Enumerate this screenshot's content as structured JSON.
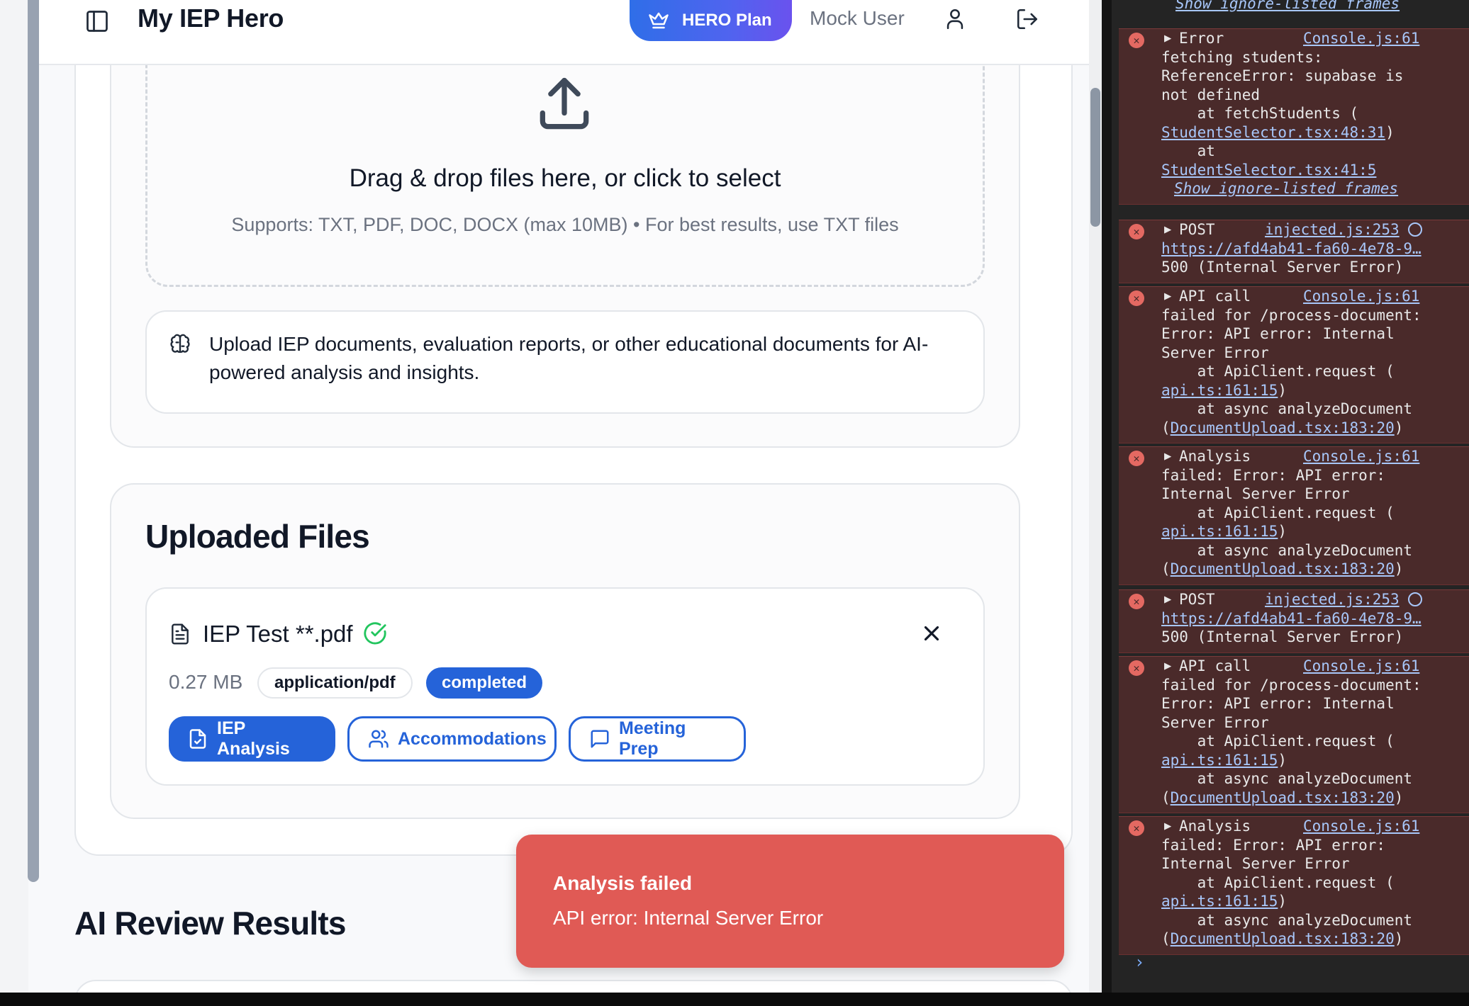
{
  "app": {
    "title": "My IEP Hero",
    "plan_label": "HERO Plan",
    "user_name": "Mock User"
  },
  "upload": {
    "title": "Drag & drop files here, or click to select",
    "subtitle": "Supports: TXT, PDF, DOC, DOCX (max 10MB) • For best results, use TXT files",
    "info": "Upload IEP documents, evaluation reports, or other educational documents for AI-powered analysis and insights."
  },
  "files": {
    "heading": "Uploaded Files",
    "items": [
      {
        "name": "IEP Test **.pdf",
        "size": "0.27 MB",
        "mime": "application/pdf",
        "status": "completed",
        "actions": [
          "IEP Analysis",
          "Accommodations",
          "Meeting Prep"
        ]
      }
    ]
  },
  "review": {
    "heading": "AI Review Results"
  },
  "toast": {
    "title": "Analysis failed",
    "message": "API error: Internal Server Error"
  },
  "console": {
    "top_ignored": "Show ignore-listed frames",
    "messages": [
      {
        "head": "Error",
        "source": "Console.js:61",
        "lines": [
          "fetching students:",
          "ReferenceError: supabase is",
          "not defined",
          "    at fetchStudents (",
          "StudentSelector.tsx:48:31)",
          "    at",
          "StudentSelector.tsx:41:5"
        ],
        "ignored": "Show ignore-listed frames"
      },
      {
        "head": "POST",
        "source": "injected.js:253",
        "lines": [
          "https://afd4ab41-fa60-4e78-9…",
          "500 (Internal Server Error)"
        ]
      },
      {
        "head": "API call",
        "source": "Console.js:61",
        "lines": [
          "failed for /process-document:",
          "Error: API error: Internal",
          "Server Error",
          "    at ApiClient.request (",
          "api.ts:161:15)",
          "    at async analyzeDocument",
          "(DocumentUpload.tsx:183:20)"
        ]
      },
      {
        "head": "Analysis",
        "source": "Console.js:61",
        "lines": [
          "failed: Error: API error:",
          "Internal Server Error",
          "    at ApiClient.request (",
          "api.ts:161:15)",
          "    at async analyzeDocument",
          "(DocumentUpload.tsx:183:20)"
        ]
      },
      {
        "head": "POST",
        "source": "injected.js:253",
        "lines": [
          "https://afd4ab41-fa60-4e78-9…",
          "500 (Internal Server Error)"
        ]
      },
      {
        "head": "API call",
        "source": "Console.js:61",
        "lines": [
          "failed for /process-document:",
          "Error: API error: Internal",
          "Server Error",
          "    at ApiClient.request (",
          "api.ts:161:15)",
          "    at async analyzeDocument",
          "(DocumentUpload.tsx:183:20)"
        ]
      },
      {
        "head": "Analysis",
        "source": "Console.js:61",
        "lines": [
          "failed: Error: API error:",
          "Internal Server Error",
          "    at ApiClient.request (",
          "api.ts:161:15)",
          "    at async analyzeDocument",
          "(DocumentUpload.tsx:183:20)"
        ]
      }
    ],
    "prompt": "›"
  },
  "colors": {
    "primary": "#2563d9",
    "toast_bg": "#e05a55",
    "success": "#22c55e",
    "console_error_bg": "#4a2a2a"
  }
}
